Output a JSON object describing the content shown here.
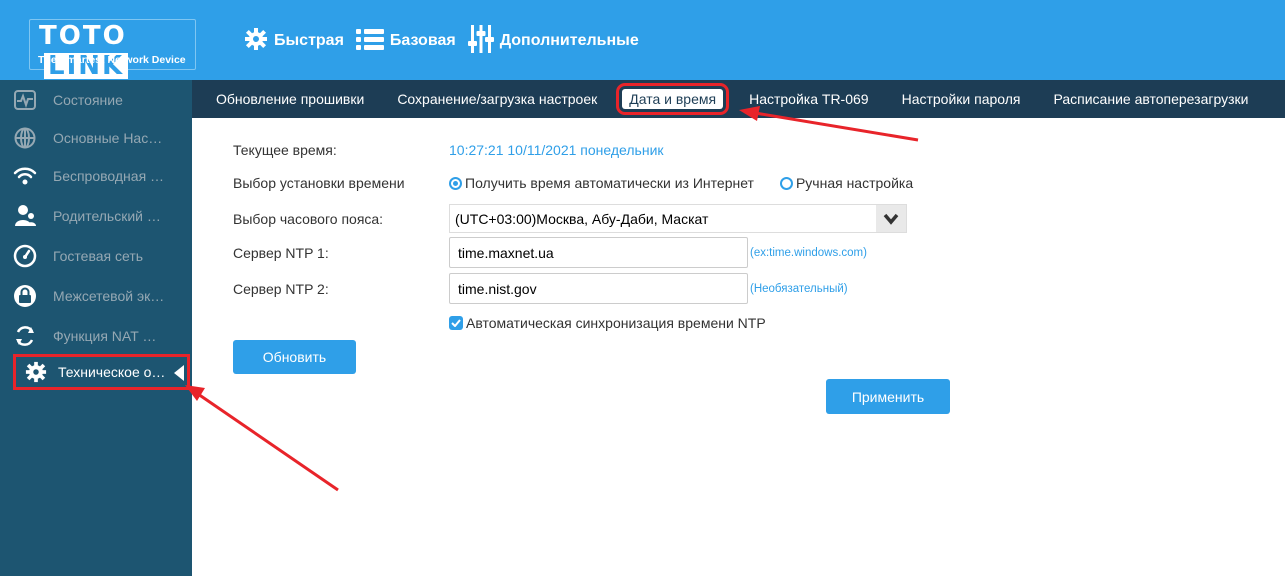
{
  "brand": {
    "logo_left": "TOTO",
    "logo_right": "LINK",
    "tagline": "The Smartest Network Device",
    "accent_color": "#2f9fe8",
    "annotation_color": "#e8242a"
  },
  "topnav": {
    "items": [
      {
        "label": "Быстрая",
        "icon": "gear-icon"
      },
      {
        "label": "Базовая",
        "icon": "list-icon"
      },
      {
        "label": "Дополнительные",
        "icon": "sliders-icon"
      }
    ]
  },
  "sidebar": {
    "items": [
      {
        "label": "Состояние",
        "icon": "pulse-icon"
      },
      {
        "label": "Основные Нас…",
        "icon": "globe-icon"
      },
      {
        "label": "Беспроводная …",
        "icon": "wifi-icon"
      },
      {
        "label": "Родительский …",
        "icon": "parental-icon"
      },
      {
        "label": "Гостевая сеть",
        "icon": "gauge-icon"
      },
      {
        "label": "Межсетевой эк…",
        "icon": "firewall-icon"
      },
      {
        "label": "Функция NAT …",
        "icon": "refresh-icon"
      },
      {
        "label": "Техническое о…",
        "icon": "gear-icon",
        "active": true
      }
    ]
  },
  "subnav": {
    "items": [
      {
        "label": "Обновление прошивки"
      },
      {
        "label": "Сохранение/загрузка настроек"
      },
      {
        "label": "Дата и время",
        "active": true
      },
      {
        "label": "Настройка TR-069"
      },
      {
        "label": "Настройки пароля"
      },
      {
        "label": "Расписание автоперезагрузки"
      }
    ]
  },
  "form": {
    "current_time_label": "Текущее время:",
    "current_time_value": "10:27:21  10/11/2021  понедельник",
    "time_mode_label": "Выбор установки времени",
    "time_mode_auto": "Получить время автоматически из Интернет",
    "time_mode_manual": "Ручная настройка",
    "timezone_label": "Выбор часового пояса:",
    "timezone_value": "(UTC+03:00)Москва, Абу-Даби, Маскат",
    "ntp1_label": "Сервер NTP 1:",
    "ntp1_value": "time.maxnet.ua",
    "ntp1_hint": "(ex:time.windows.com)",
    "ntp2_label": "Сервер NTP 2:",
    "ntp2_value": "time.nist.gov",
    "ntp2_hint": "(Необязательный)",
    "auto_sync_label": "Автоматическая синхронизация времени NTP",
    "refresh_button": "Обновить",
    "apply_button": "Применить"
  }
}
